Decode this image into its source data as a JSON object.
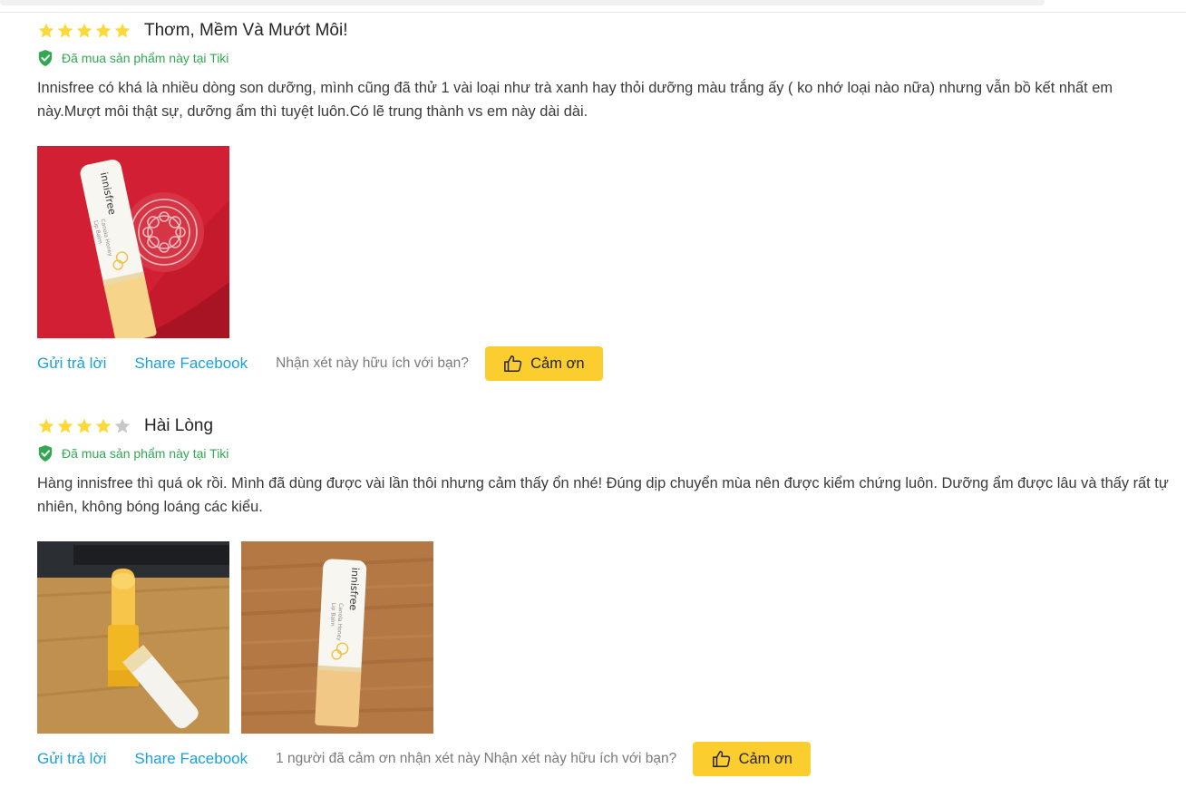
{
  "reviews": [
    {
      "title": "Thơm, Mềm Và Mướt Môi!",
      "rating": 5,
      "max_rating": 5,
      "verified": "Đã mua sản phẩm này tại Tiki",
      "content": "Innisfree có khá là nhiều dòng son dưỡng, mình cũng đã thử 1 vài loại như trà xanh hay thỏi dưỡng màu trắng ấy ( ko nhớ loại nào nữa) nhưng vẫn bồ kết nhất em này.Mượt môi thật sự, dưỡng ẩm thì tuyệt luôn.Có lẽ trung thành vs em này dài dài.",
      "reply_label": "Gửi trả lời",
      "share_label": "Share Facebook",
      "thanks_count": "",
      "helpful_prompt": "Nhận xét này hữu ích với bạn?",
      "thanks_label": "Cảm ơn"
    },
    {
      "title": "Hài Lòng",
      "rating": 4,
      "max_rating": 5,
      "verified": "Đã mua sản phẩm này tại Tiki",
      "content": "Hàng innisfree thì quá ok rồi. Mình đã dùng được vài lần thôi nhưng cảm thấy ổn nhé! Đúng dịp chuyển mùa nên được kiểm chứng luôn. Dưỡng ẩm được lâu và thấy rất tự nhiên, không bóng loáng các kiểu.",
      "reply_label": "Gửi trả lời",
      "share_label": "Share Facebook",
      "thanks_count": "1 người đã cảm ơn nhận xét này",
      "helpful_prompt": "Nhận xét này hữu ích với bạn?",
      "thanks_label": "Cảm ơn"
    }
  ],
  "photos": {
    "brand": "innisfree",
    "product_line": [
      "Canola Honey",
      "Lip Balm"
    ]
  },
  "colors": {
    "star_filled": "#fdd836",
    "star_empty": "#c7c7c7",
    "verified_green": "#32a852",
    "link_blue": "#1ba0d8",
    "button_yellow": "#fccd2f"
  }
}
